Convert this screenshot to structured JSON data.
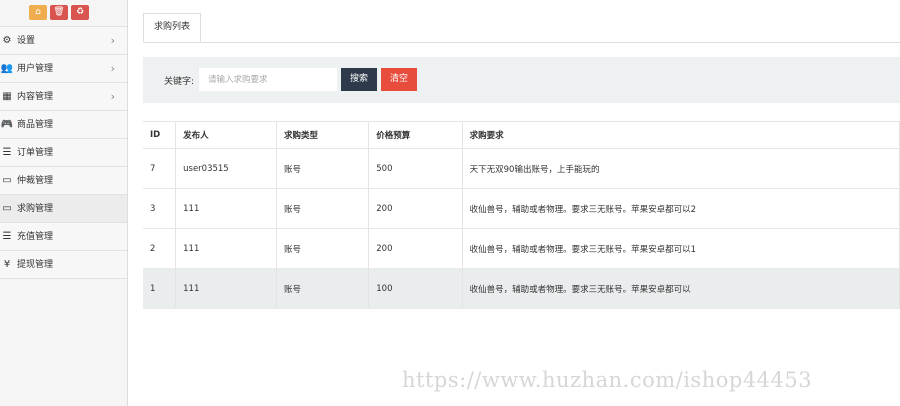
{
  "quick_bar": {
    "home_icon": "⌂",
    "trash_icon": "🗑",
    "recycle_icon": "♻"
  },
  "sidebar": {
    "items": [
      {
        "label": "设置",
        "icon": "⚙",
        "chevron": "›",
        "active": false
      },
      {
        "label": "用户管理",
        "icon": "👥",
        "chevron": "›",
        "active": false
      },
      {
        "label": "内容管理",
        "icon": "▦",
        "chevron": "›",
        "active": false
      },
      {
        "label": "商品管理",
        "icon": "🎮",
        "active": false
      },
      {
        "label": "订单管理",
        "icon": "☰",
        "active": false
      },
      {
        "label": "仲裁管理",
        "icon": "▭",
        "active": false
      },
      {
        "label": "求购管理",
        "icon": "▭",
        "active": true
      },
      {
        "label": "充值管理",
        "icon": "☰",
        "active": false
      },
      {
        "label": "提现管理",
        "icon": "¥",
        "active": false
      }
    ]
  },
  "tabs": {
    "active_label": "求购列表"
  },
  "search": {
    "label": "关键字:",
    "placeholder": "请输入求购要求",
    "search_label": "搜索",
    "clear_label": "清空",
    "search_color": "#2e3a4b",
    "clear_color": "#e74c3c"
  },
  "table": {
    "headers": [
      "ID",
      "发布人",
      "求购类型",
      "价格预算",
      "求购要求"
    ],
    "rows": [
      [
        "7",
        "user03515",
        "账号",
        "500",
        "天下无双90输出账号，上手能玩的"
      ],
      [
        "3",
        "111",
        "账号",
        "200",
        "收仙兽号，辅助或者物理。要求三无账号。苹果安卓都可以2"
      ],
      [
        "2",
        "111",
        "账号",
        "200",
        "收仙兽号，辅助或者物理。要求三无账号。苹果安卓都可以1"
      ],
      [
        "1",
        "111",
        "账号",
        "100",
        "收仙兽号，辅助或者物理。要求三无账号。苹果安卓都可以"
      ]
    ]
  },
  "watermark": "https://www.huzhan.com/ishop44453"
}
